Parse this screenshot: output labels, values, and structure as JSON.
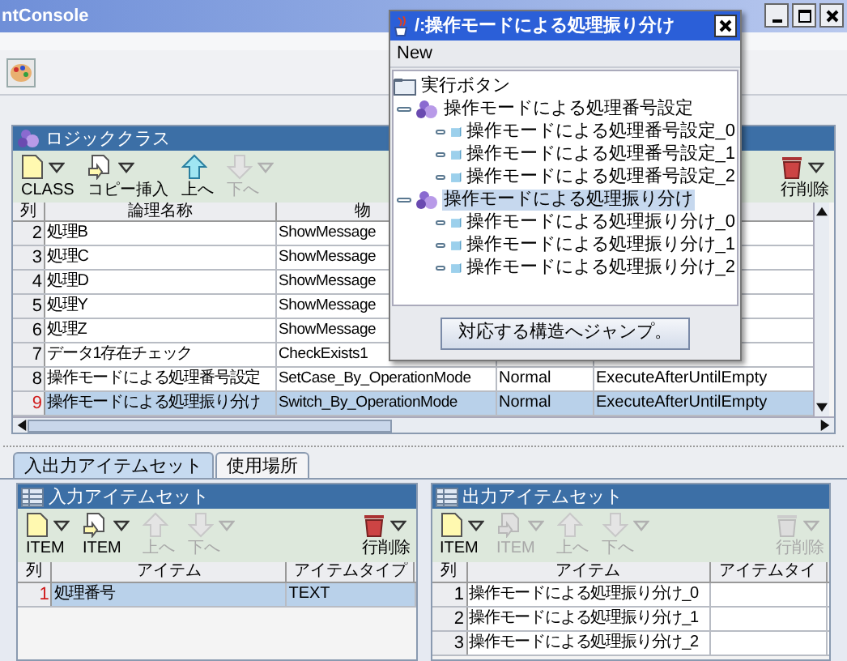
{
  "window": {
    "title": "ntConsole"
  },
  "logic_panel": {
    "title": "ロジッククラス",
    "toolbar": [
      {
        "kind": "new",
        "label": "CLASS",
        "disabled": false,
        "menu": true
      },
      {
        "kind": "copy",
        "label": "コピー挿入",
        "disabled": false,
        "menu": true
      },
      {
        "kind": "up",
        "label": "上へ",
        "disabled": false,
        "menu": false
      },
      {
        "kind": "down",
        "label": "下へ",
        "disabled": true,
        "menu": true
      },
      {
        "kind": "delete",
        "label": "行削除",
        "disabled": false,
        "menu": true
      }
    ],
    "columns": [
      "列",
      "論理名称",
      "物"
    ],
    "rows": [
      {
        "number": "2",
        "logical_name": "処理B",
        "physical_name": "ShowMessage",
        "selected": false
      },
      {
        "number": "3",
        "logical_name": "処理C",
        "physical_name": "ShowMessage",
        "selected": false
      },
      {
        "number": "4",
        "logical_name": "処理D",
        "physical_name": "ShowMessage",
        "selected": false
      },
      {
        "number": "5",
        "logical_name": "処理Y",
        "physical_name": "ShowMessage",
        "selected": false
      },
      {
        "number": "6",
        "logical_name": "処理Z",
        "physical_name": "ShowMessage",
        "selected": false
      },
      {
        "number": "7",
        "logical_name": "データ1存在チェック",
        "physical_name": "CheckExists1",
        "selected": false
      },
      {
        "number": "8",
        "logical_name": "操作モードによる処理番号設定",
        "physical_name": "SetCase_By_OperationMode",
        "column_4": "Normal",
        "column_5": "ExecuteAfterUntilEmpty",
        "selected": false
      },
      {
        "number": "9",
        "logical_name": "操作モードによる処理振り分け",
        "physical_name": "Switch_By_OperationMode",
        "column_4": "Normal",
        "column_5": "ExecuteAfterUntilEmpty",
        "selected": true
      }
    ]
  },
  "tabs": [
    {
      "label": "入出力アイテムセット",
      "selected": true
    },
    {
      "label": "使用場所",
      "selected": false
    }
  ],
  "input_panel": {
    "title": "入力アイテムセット",
    "toolbar": [
      {
        "kind": "new",
        "label": "ITEM",
        "disabled": false,
        "menu": true
      },
      {
        "kind": "copy",
        "label": "ITEM",
        "disabled": false,
        "menu": true
      },
      {
        "kind": "up",
        "label": "上へ",
        "disabled": true,
        "menu": false
      },
      {
        "kind": "down",
        "label": "下へ",
        "disabled": true,
        "menu": true
      },
      {
        "kind": "delete",
        "label": "行削除",
        "disabled": false,
        "menu": true
      }
    ],
    "columns": [
      "列",
      "アイテム",
      "アイテムタイプ"
    ],
    "rows": [
      {
        "number": "1",
        "item": "処理番号",
        "type": "TEXT",
        "selected": true
      }
    ]
  },
  "output_panel": {
    "title": "出力アイテムセット",
    "toolbar": [
      {
        "kind": "new",
        "label": "ITEM",
        "disabled": false,
        "menu": true
      },
      {
        "kind": "copy",
        "label": "ITEM",
        "disabled": true,
        "menu": true
      },
      {
        "kind": "up",
        "label": "上へ",
        "disabled": true,
        "menu": false
      },
      {
        "kind": "down",
        "label": "下へ",
        "disabled": true,
        "menu": true
      },
      {
        "kind": "delete",
        "label": "行削除",
        "disabled": true,
        "menu": true
      }
    ],
    "columns": [
      "列",
      "アイテム",
      "アイテムタイ"
    ],
    "rows": [
      {
        "number": "1",
        "item": "操作モードによる処理振り分け_0",
        "selected": false
      },
      {
        "number": "2",
        "item": "操作モードによる処理振り分け_1",
        "selected": false
      },
      {
        "number": "3",
        "item": "操作モードによる処理振り分け_2",
        "selected": false
      }
    ]
  },
  "popup": {
    "title": "/:操作モードによる処理振り分け",
    "menu": [
      "New"
    ],
    "tree": [
      {
        "kind": "root",
        "label": "実行ボタン",
        "selected": false,
        "children": [
          {
            "kind": "group",
            "label": "操作モードによる処理番号設定",
            "selected": false,
            "children": [
              {
                "kind": "leaf",
                "label": "操作モードによる処理番号設定_0",
                "selected": false
              },
              {
                "kind": "leaf",
                "label": "操作モードによる処理番号設定_1",
                "selected": false
              },
              {
                "kind": "leaf",
                "label": "操作モードによる処理番号設定_2",
                "selected": false
              }
            ]
          },
          {
            "kind": "group",
            "label": "操作モードによる処理振り分け",
            "selected": true,
            "children": [
              {
                "kind": "leaf",
                "label": "操作モードによる処理振り分け_0",
                "selected": false
              },
              {
                "kind": "leaf",
                "label": "操作モードによる処理振り分け_1",
                "selected": false
              },
              {
                "kind": "leaf",
                "label": "操作モードによる処理振り分け_2",
                "selected": false
              }
            ]
          }
        ]
      }
    ],
    "button": "対応する構造へジャンプ。"
  }
}
